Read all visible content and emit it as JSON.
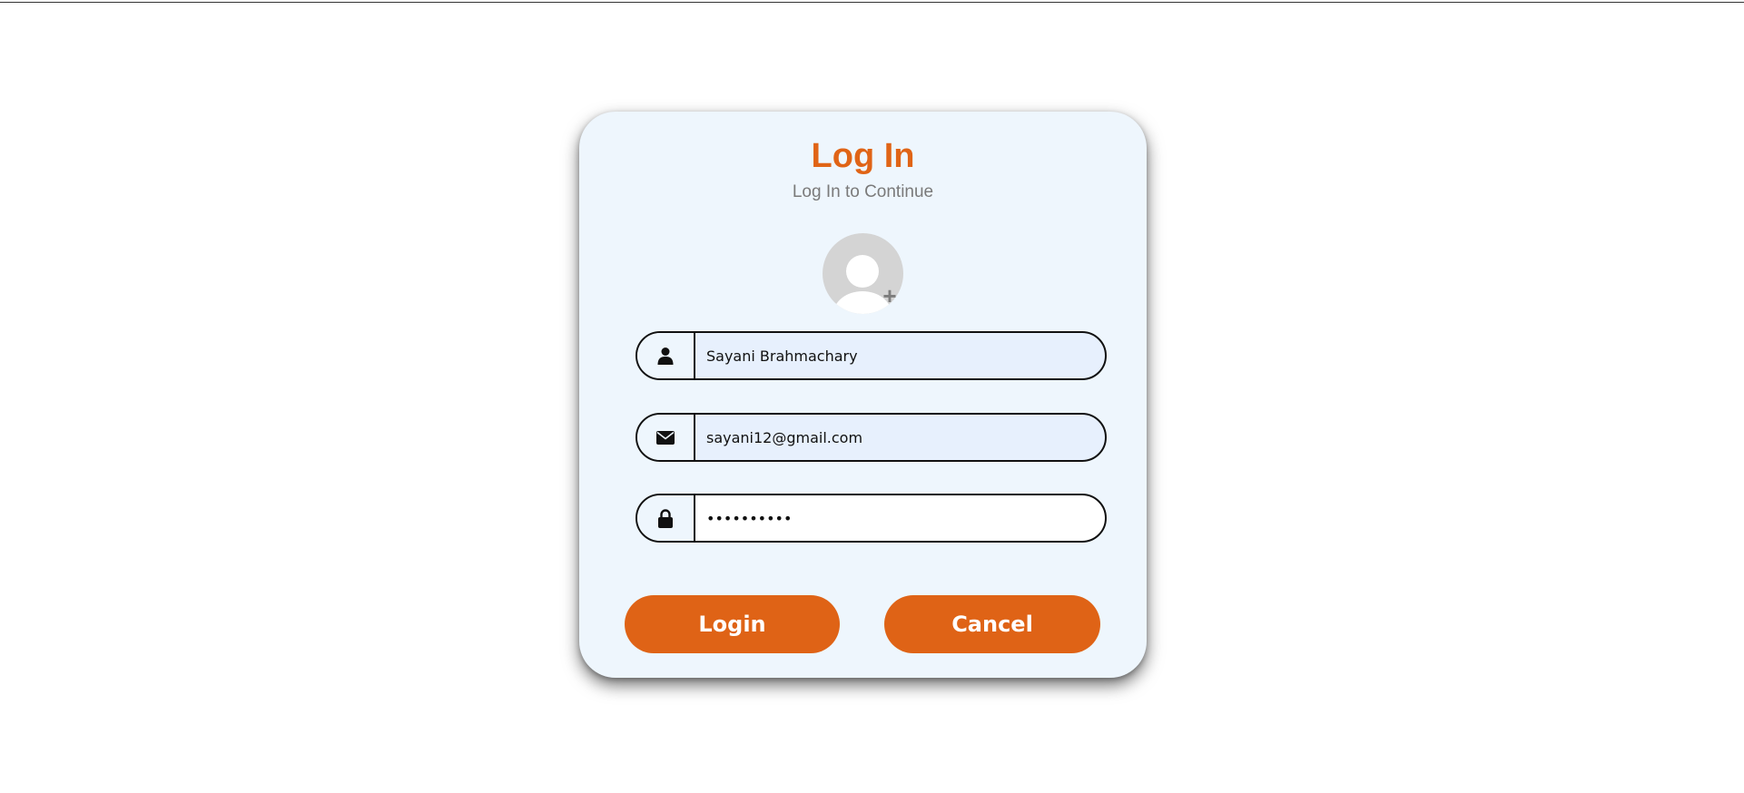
{
  "header": {
    "title": "Log In",
    "subtitle": "Log In to Continue"
  },
  "avatar": {
    "icon": "user-avatar-icon",
    "add_icon": "plus-icon",
    "add_glyph": "+"
  },
  "form": {
    "name": {
      "icon": "user-icon",
      "value": "Sayani Brahmachary"
    },
    "email": {
      "icon": "envelope-icon",
      "value": "sayani12@gmail.com"
    },
    "password": {
      "icon": "lock-icon",
      "value": "••••••••••"
    }
  },
  "buttons": {
    "login_label": "Login",
    "cancel_label": "Cancel"
  },
  "colors": {
    "accent": "#df6316",
    "card_background": "#eef6fd",
    "field_background": "#e7f0fd"
  }
}
